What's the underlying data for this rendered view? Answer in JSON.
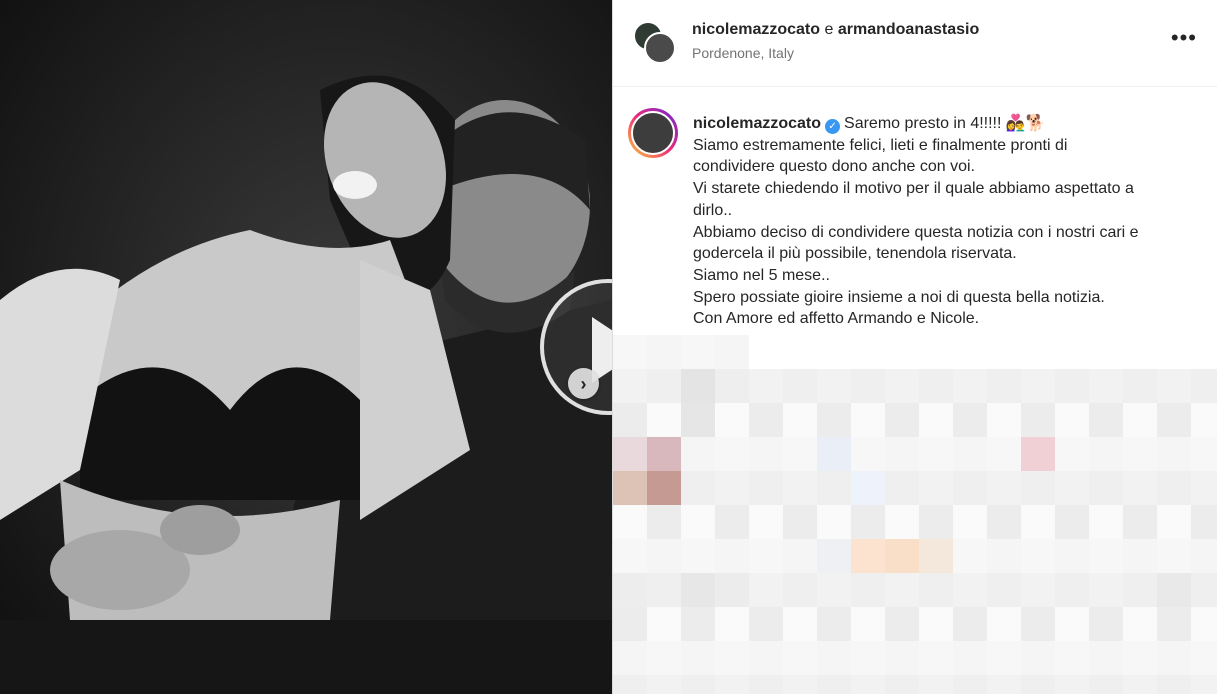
{
  "header": {
    "user1": "nicolemazzocato",
    "connector": "e",
    "user2": "armandoanastasio",
    "location": "Pordenone, Italy",
    "more": "•••"
  },
  "caption": {
    "username": "nicolemazzocato",
    "verified_icon": "✓",
    "title": "Saremo presto in 4!!!!! 👩‍❤️‍👨🐕",
    "lines": [
      "Siamo estremamente felici, lieti e finalmente pronti di",
      "condividere questo dono anche con voi.",
      "Vi starete chiedendo il motivo per il quale abbiamo aspettato a",
      "dirlo..",
      "Abbiamo deciso di condividere questa notizia con i nostri cari e",
      "godercela il più possibile, tenendola riservata.",
      "Siamo nel 5 mese..",
      "Spero possiate gioire insieme a noi di questa bella notizia.",
      "Con Amore ed affetto Armando e Nicole."
    ]
  },
  "media": {
    "next_icon": "›"
  },
  "colors": {
    "text": "#262626",
    "secondary": "#737373",
    "verified": "#3897f0"
  }
}
